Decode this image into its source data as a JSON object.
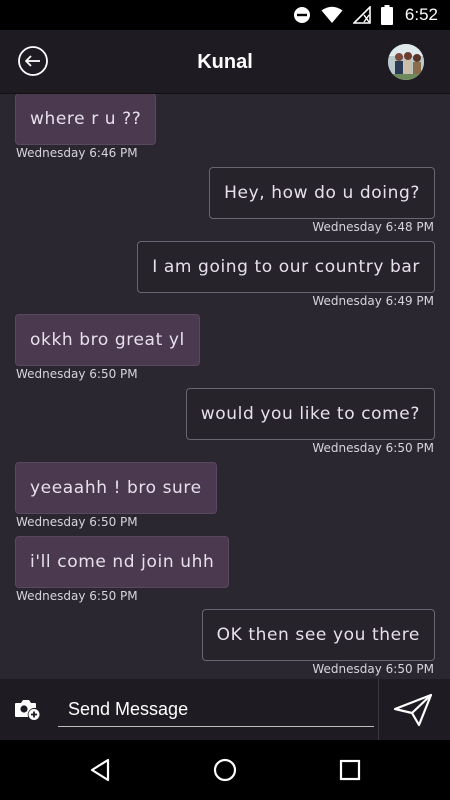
{
  "status_bar": {
    "time": "6:52",
    "icons": [
      "do-not-disturb-icon",
      "wifi-icon",
      "no-signal-icon",
      "battery-icon"
    ]
  },
  "header": {
    "title": "Kunal",
    "back_icon": "back-arrow-icon",
    "avatar": "contact-avatar"
  },
  "messages": [
    {
      "direction": "incoming",
      "text": "where r u ??",
      "time": "Wednesday 6:46 PM"
    },
    {
      "direction": "outgoing",
      "text": "Hey, how do u doing?",
      "time": "Wednesday 6:48 PM"
    },
    {
      "direction": "outgoing",
      "text": "I am going to our country bar",
      "time": "Wednesday 6:49 PM"
    },
    {
      "direction": "incoming",
      "text": "okkh bro great yl",
      "time": "Wednesday 6:50 PM"
    },
    {
      "direction": "outgoing",
      "text": "would you like to come?",
      "time": "Wednesday 6:50 PM"
    },
    {
      "direction": "incoming",
      "text": "yeeaahh ! bro sure",
      "time": "Wednesday 6:50 PM"
    },
    {
      "direction": "incoming",
      "text": "i'll come nd join uhh",
      "time": "Wednesday 6:50 PM"
    },
    {
      "direction": "outgoing",
      "text": "OK then see you there",
      "time": "Wednesday 6:50 PM"
    }
  ],
  "composer": {
    "placeholder": "Send Message",
    "attach_icon": "add-photo-icon",
    "send_icon": "send-icon"
  },
  "nav_bar": {
    "icons": [
      "back-triangle-icon",
      "home-circle-icon",
      "recents-square-icon"
    ]
  },
  "colors": {
    "background": "#2a2730",
    "incoming_bubble": "#4b3a4f",
    "outgoing_bubble_border": "#6a6570",
    "app_bar": "#1e1c22"
  }
}
